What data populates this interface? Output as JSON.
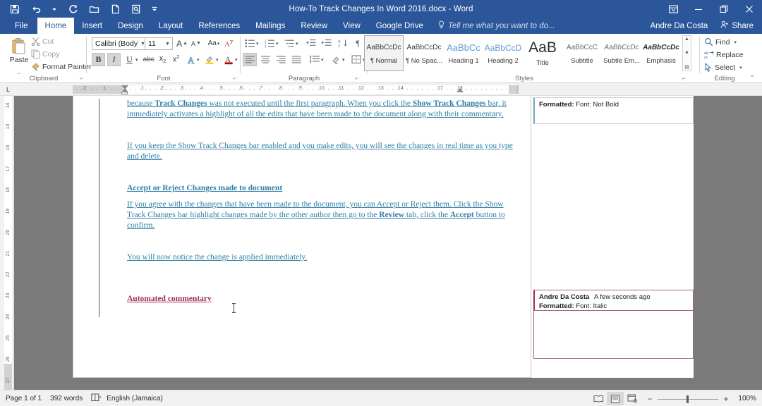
{
  "titlebar": {
    "document_title": "How-To Track Changes In Word 2016.docx - Word",
    "qat": [
      {
        "name": "save-icon",
        "label": "Save"
      },
      {
        "name": "undo-icon",
        "label": "Undo"
      },
      {
        "name": "redo-icon",
        "label": "Redo"
      },
      {
        "name": "open-icon",
        "label": "Open"
      },
      {
        "name": "new-icon",
        "label": "New"
      },
      {
        "name": "print-preview-icon",
        "label": "Print Preview and Print"
      },
      {
        "name": "customize-qat-icon",
        "label": "Customize Quick Access Toolbar"
      }
    ],
    "window_controls": [
      {
        "name": "ribbon-display-options-icon",
        "label": "Ribbon Display Options"
      },
      {
        "name": "minimize-icon",
        "label": "Minimize"
      },
      {
        "name": "restore-icon",
        "label": "Restore Down"
      },
      {
        "name": "close-icon",
        "label": "Close"
      }
    ]
  },
  "tabs": {
    "items": [
      {
        "id": "file",
        "label": "File"
      },
      {
        "id": "home",
        "label": "Home"
      },
      {
        "id": "insert",
        "label": "Insert"
      },
      {
        "id": "design",
        "label": "Design"
      },
      {
        "id": "layout",
        "label": "Layout"
      },
      {
        "id": "references",
        "label": "References"
      },
      {
        "id": "mailings",
        "label": "Mailings"
      },
      {
        "id": "review",
        "label": "Review"
      },
      {
        "id": "view",
        "label": "View"
      },
      {
        "id": "google-drive",
        "label": "Google Drive"
      }
    ],
    "active": "Home",
    "tell_me": "Tell me what you want to do...",
    "user_name": "Andre Da Costa",
    "share_label": "Share"
  },
  "ribbon": {
    "groups": [
      {
        "id": "clipboard",
        "label": "Clipboard"
      },
      {
        "id": "font",
        "label": "Font"
      },
      {
        "id": "paragraph",
        "label": "Paragraph"
      },
      {
        "id": "styles",
        "label": "Styles"
      },
      {
        "id": "editing",
        "label": "Editing"
      }
    ],
    "clipboard": {
      "paste_label": "Paste",
      "cut_label": "Cut",
      "copy_label": "Copy",
      "format_painter_label": "Format Painter"
    },
    "font": {
      "font_name": "Calibri (Body)",
      "font_size": "11",
      "grow_font": "A",
      "shrink_font": "A",
      "change_case": "Aa",
      "clear_formatting_label": "Clear All Formatting",
      "bold": "B",
      "italic": "I",
      "underline": "U",
      "strikethrough": "abc",
      "subscript": "x",
      "superscript": "x",
      "text_effects": "A",
      "highlight": "ab",
      "font_color": "A"
    },
    "paragraph": {
      "bullets": "Bullets",
      "numbering": "Numbering",
      "multilevel": "Multilevel List",
      "decrease_indent": "Decrease Indent",
      "increase_indent": "Increase Indent",
      "sort": "Sort",
      "show_marks": "¶",
      "align_left": "Align Left",
      "center": "Center",
      "align_right": "Align Right",
      "justify": "Justify",
      "line_spacing": "Line and Paragraph Spacing",
      "shading": "Shading",
      "borders": "Borders"
    },
    "styles": {
      "items": [
        {
          "sample": "AaBbCcDc",
          "name": "¶ Normal",
          "selected": true
        },
        {
          "sample": "AaBbCcDc",
          "name": "¶ No Spac...",
          "selected": false
        },
        {
          "sample": "AaBbCc",
          "name": "Heading 1",
          "selected": false
        },
        {
          "sample": "AaBbCcD",
          "name": "Heading 2",
          "selected": false
        },
        {
          "sample": "AaB",
          "name": "Title",
          "selected": false
        },
        {
          "sample": "AaBbCcC",
          "name": "Subtitle",
          "selected": false
        },
        {
          "sample": "AaBbCcDc",
          "name": "Subtle Em...",
          "selected": false
        },
        {
          "sample": "AaBbCcDc",
          "name": "Emphasis",
          "selected": false
        }
      ]
    },
    "editing": {
      "find_label": "Find",
      "replace_label": "Replace",
      "select_label": "Select"
    },
    "collapse_ribbon_label": "Collapse the Ribbon"
  },
  "ruler": {
    "horizontal_ticks": [
      "2",
      "1",
      "1",
      "2",
      "3",
      "4",
      "5",
      "6",
      "7",
      "8",
      "9",
      "10",
      "11",
      "12",
      "13",
      "14",
      "15",
      "17",
      "18"
    ],
    "vertical_ticks": [
      "14",
      "15",
      "16",
      "17",
      "18",
      "19",
      "20",
      "21",
      "22",
      "23",
      "24",
      "25",
      "26",
      "27"
    ],
    "tab_stop_selector": "L"
  },
  "document": {
    "paragraphs": [
      {
        "id": "p1",
        "color": "teal",
        "runs": [
          {
            "text": "because ",
            "bold": false
          },
          {
            "text": "Track Changes",
            "bold": true
          },
          {
            "text": " was not executed until the first paragraph. When you click the ",
            "bold": false
          },
          {
            "text": "Show Track Changes",
            "bold": true
          },
          {
            "text": " bar, it immediately activates a highlight of all the edits that have been made to the document along with their commentary.",
            "bold": false
          }
        ]
      },
      {
        "id": "p2",
        "color": "teal",
        "runs": [
          {
            "text": "If you keep the Show Track Changes bar enabled and you make edits, you will see the changes in real time as you type and delete.",
            "bold": false
          }
        ]
      },
      {
        "id": "p3",
        "color": "teal",
        "runs": [
          {
            "text": "Accept or Reject Changes made to document",
            "bold": true
          }
        ]
      },
      {
        "id": "p4",
        "color": "teal",
        "runs": [
          {
            "text": "If you agree with the changes that have been made to the document, you can Accept or Reject them. Click the Show Track Changes bar highlight changes made by the other author then go to the ",
            "bold": false
          },
          {
            "text": "Review",
            "bold": true
          },
          {
            "text": " tab, click the ",
            "bold": false
          },
          {
            "text": "Accept",
            "bold": true
          },
          {
            "text": " button to confirm.",
            "bold": false
          }
        ]
      },
      {
        "id": "p5",
        "color": "teal",
        "runs": [
          {
            "text": "You will now notice the change is applied immediately.",
            "bold": false
          }
        ]
      },
      {
        "id": "p6",
        "color": "maroon",
        "runs": [
          {
            "text": "Automated commentary",
            "bold": true
          }
        ]
      }
    ]
  },
  "markup_pane": {
    "balloons": [
      {
        "id": "formatted-not-bold",
        "kind": "format-change",
        "author": "",
        "timestamp": "",
        "label": "Formatted:",
        "detail": "Font: Not Bold"
      },
      {
        "id": "formatted-italic",
        "kind": "comment",
        "author": "Andre Da Costa",
        "timestamp": "A few seconds ago",
        "label": "Formatted:",
        "detail": "Font: Italic"
      }
    ]
  },
  "statusbar": {
    "page": "Page 1 of 1",
    "words": "392 words",
    "proofing_icon_label": "Proofing errors",
    "language": "English (Jamaica)",
    "views": [
      {
        "id": "read-mode",
        "label": "Read Mode",
        "active": false
      },
      {
        "id": "print-layout",
        "label": "Print Layout",
        "active": true
      },
      {
        "id": "web-layout",
        "label": "Web Layout",
        "active": false
      }
    ],
    "zoom_out": "−",
    "zoom_in": "+",
    "zoom_value": "100%"
  },
  "colors": {
    "brand_blue": "#2b579a",
    "tracked_teal": "#2f7fa5",
    "tracked_maroon": "#9e2b4e",
    "ribbon_bg": "#ffffff",
    "workspace_gray": "#7a7a7a"
  }
}
